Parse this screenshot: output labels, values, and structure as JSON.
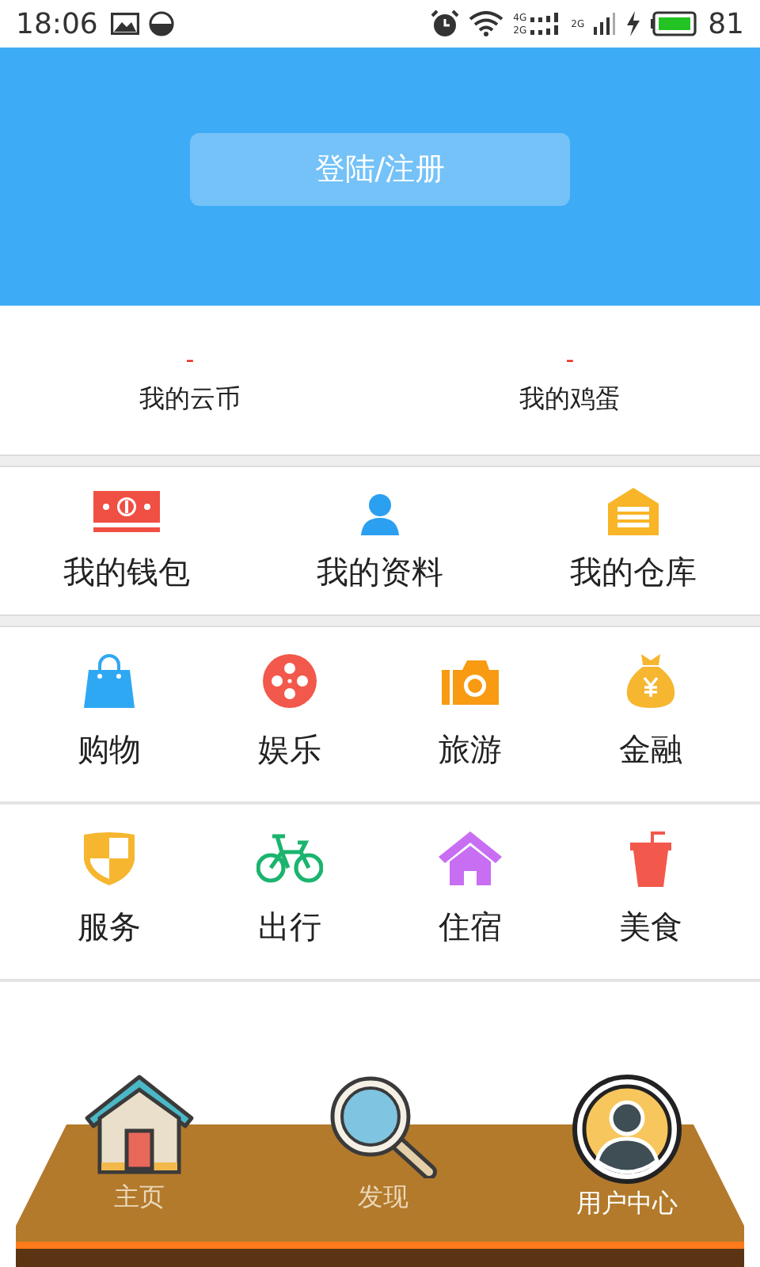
{
  "status_bar": {
    "time": "18:06",
    "network_labels": [
      "4G",
      "2G",
      "2G"
    ],
    "battery": "81"
  },
  "header": {
    "login_button": "登陆/注册"
  },
  "stats": [
    {
      "value": "-",
      "label": "我的云币"
    },
    {
      "value": "-",
      "label": "我的鸡蛋"
    }
  ],
  "account_items": [
    {
      "kind": "wallet",
      "label": "我的钱包"
    },
    {
      "kind": "profile",
      "label": "我的资料"
    },
    {
      "kind": "warehouse",
      "label": "我的仓库"
    }
  ],
  "service_rows": [
    [
      {
        "kind": "bag",
        "label": "购物"
      },
      {
        "kind": "reel",
        "label": "娱乐"
      },
      {
        "kind": "camera",
        "label": "旅游"
      },
      {
        "kind": "moneybag",
        "label": "金融"
      }
    ],
    [
      {
        "kind": "shield",
        "label": "服务"
      },
      {
        "kind": "bike",
        "label": "出行"
      },
      {
        "kind": "house",
        "label": "住宿"
      },
      {
        "kind": "cup",
        "label": "美食"
      }
    ]
  ],
  "bottom_nav": [
    {
      "kind": "home",
      "label": "主页",
      "selected": false
    },
    {
      "kind": "search",
      "label": "发现",
      "selected": false
    },
    {
      "kind": "user",
      "label": "用户中心",
      "selected": true
    }
  ]
}
